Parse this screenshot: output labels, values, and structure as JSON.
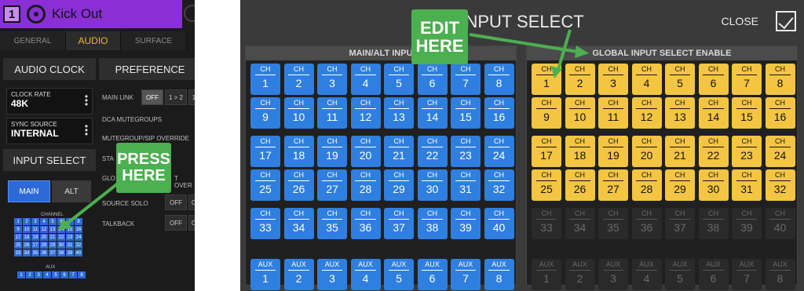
{
  "left": {
    "channel_number": "1",
    "channel_name": "Kick Out",
    "tabs": [
      "GENERAL",
      "AUDIO",
      "SURFACE"
    ],
    "audio_clock_title": "AUDIO CLOCK",
    "clock_rate_label": "CLOCK RATE",
    "clock_rate_value": "48K",
    "sync_source_label": "SYNC SOURCE",
    "sync_source_value": "INTERNAL",
    "input_select_title": "INPUT SELECT",
    "main_label": "MAIN",
    "alt_label": "ALT",
    "channel_label": "CHANNEL",
    "aux_label": "AUX",
    "preferences_title": "PREFERENCE",
    "pref_rows": [
      "MAIN LINK",
      "DCA MUTEGROUPS",
      "MUTEGROUP/SIP OVERRIDE",
      "STA",
      "GLO",
      "SOURCE SOLO",
      "TALKBACK"
    ],
    "main_link_options": [
      "OFF",
      "1 > 2",
      "1"
    ],
    "t_over": "T OVER",
    "off_label": "OFF",
    "o_label": "O"
  },
  "right": {
    "title": "INPUT SELECT",
    "close_label": "CLOSE",
    "main_alt_header": "MAIN/ALT INPU",
    "global_header": "GLOBAL INPUT SELECT ENABLE",
    "ch_label": "CH",
    "aux_label": "AUX"
  },
  "callouts": {
    "press": [
      "PRESS",
      "HERE"
    ],
    "edit": [
      "EDIT",
      "HERE"
    ]
  },
  "colors": {
    "accent_purple": "#8a2fd6",
    "blue": "#2f7fe0",
    "yellow": "#f3c542",
    "callout_green": "#4caf50",
    "tab_active": "#f0b428"
  }
}
